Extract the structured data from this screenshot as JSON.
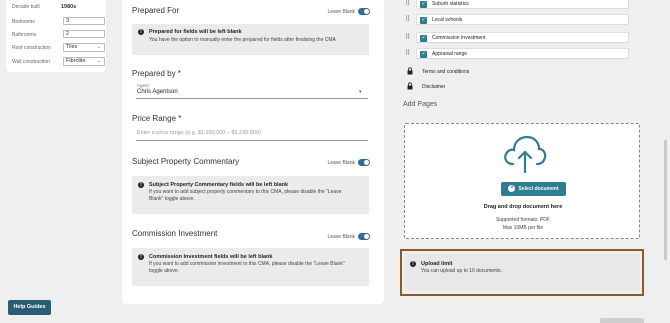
{
  "property": {
    "decade_label": "Decade built",
    "decade_value": "1980s",
    "bedrooms_label": "Bedrooms",
    "bedrooms_value": "3",
    "bathrooms_label": "Bathrooms",
    "bathrooms_value": "2",
    "roof_label": "Roof construction",
    "roof_value": "Tiles",
    "wall_label": "Wall construction",
    "wall_value": "Fibrolite"
  },
  "form": {
    "prepared_for": {
      "title": "Prepared For",
      "leave_blank": "Leave Blank",
      "info_title": "Prepared for fields will be left blank",
      "info_body": "You have the option to manually enter the prepared for fields after finalising the CMA"
    },
    "prepared_by": {
      "title": "Prepared by *",
      "agent_label": "Agent",
      "agent_value": "Chris Agentson"
    },
    "price_range": {
      "title": "Price Range *",
      "placeholder": "Enter a price range (e.g. $1,100,000 – $1,230,000)"
    },
    "commentary": {
      "title": "Subject Property Commentary",
      "leave_blank": "Leave Blank",
      "info_title": "Subject Property Commentary fields will be left blank",
      "info_body": "If you want to add subject property commentary to this CMA, please disable the \"Leave Blank\" toggle above."
    },
    "commission": {
      "title": "Commission Investment",
      "leave_blank": "Leave Blank",
      "info_title": "Commission Investment fields will be left blank",
      "info_body": "If you want to add commission investment to this CMA, please disable the \"Leave Blank\" toggle above."
    }
  },
  "pages": {
    "items": [
      {
        "label": "Suburb statistics",
        "checked": true
      },
      {
        "label": "Local schools",
        "checked": true
      },
      {
        "label": "Commission Investment",
        "checked": true
      },
      {
        "label": "Appraisal range",
        "checked": true
      }
    ],
    "locked": [
      {
        "label": "Terms and conditions"
      },
      {
        "label": "Disclaimer"
      }
    ],
    "add_pages_title": "Add Pages",
    "select_button": "Select document",
    "drag_title": "Drag and drop document here",
    "formats": "Supported formats: PDF",
    "max_size": "Max 10MB per file",
    "upload_limit_title": "Upload limit",
    "upload_limit_body": "You can upload up to 10 documents."
  },
  "help_button": "Help Guides",
  "colors": {
    "accent": "#2e7d90",
    "help": "#2a5d73",
    "highlight_border": "#8a5a2b"
  }
}
